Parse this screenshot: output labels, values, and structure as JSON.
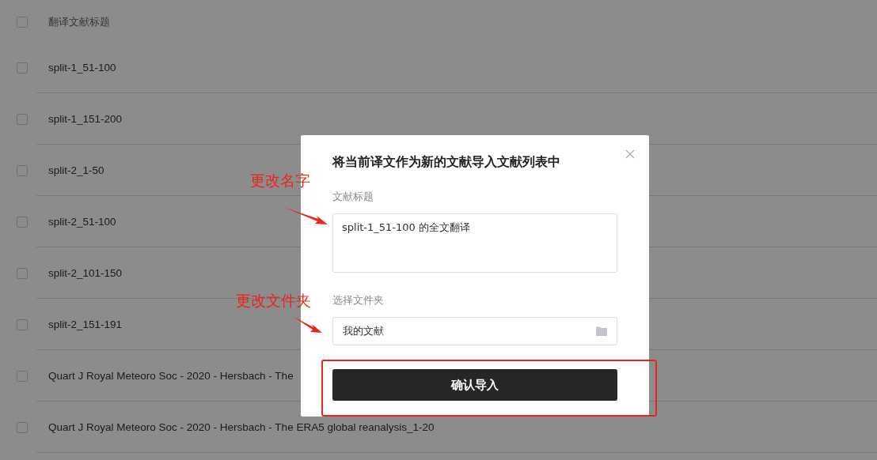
{
  "list": {
    "header": {
      "label": "翻译文献标题",
      "checked": false
    },
    "rows": [
      {
        "title": "split-1_51-100",
        "checked": false
      },
      {
        "title": "split-1_151-200",
        "checked": false
      },
      {
        "title": "split-2_1-50",
        "checked": false
      },
      {
        "title": "split-2_51-100",
        "checked": false
      },
      {
        "title": "split-2_101-150",
        "checked": false
      },
      {
        "title": "split-2_151-191",
        "checked": false
      },
      {
        "title": "Quart J Royal Meteoro Soc - 2020 - Hersbach - The",
        "checked": false
      },
      {
        "title": "Quart J Royal Meteoro Soc - 2020 - Hersbach - The ERA5 global reanalysis_1-20",
        "checked": false
      }
    ]
  },
  "dialog": {
    "title": "将当前译文作为新的文献导入文献列表中",
    "title_label": "文献标题",
    "title_value": "split-1_51-100 的全文翻译",
    "folder_label": "选择文件夹",
    "folder_value": "我的文献",
    "confirm": "确认导入"
  },
  "annotations": [
    {
      "text": "更改名字"
    },
    {
      "text": "更改文件夹"
    }
  ]
}
